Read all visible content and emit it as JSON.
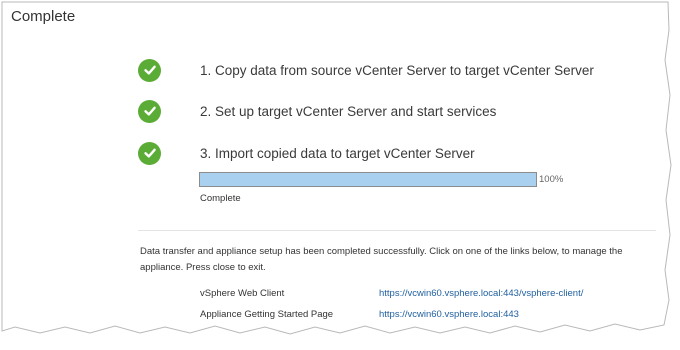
{
  "page": {
    "title": "Complete"
  },
  "steps": [
    {
      "label": "1. Copy data from source vCenter Server to target vCenter Server",
      "status_icon": "check-icon",
      "status": "complete"
    },
    {
      "label": "2. Set up target vCenter Server and start services",
      "status_icon": "check-icon",
      "status": "complete"
    },
    {
      "label": "3. Import copied data to target vCenter Server",
      "status_icon": "check-icon",
      "status": "complete"
    }
  ],
  "progress": {
    "value": 100,
    "label": "100%",
    "status": "Complete"
  },
  "summary": {
    "message": "Data transfer and appliance setup has been completed successfully. Click on one of the links below, to manage the appliance. Press close to exit."
  },
  "links": [
    {
      "label": "vSphere Web Client",
      "url": "https://vcwin60.vsphere.local:443/vsphere-client/"
    },
    {
      "label": "Appliance Getting Started Page",
      "url": "https://vcwin60.vsphere.local:443"
    }
  ],
  "colors": {
    "check": "#5aac37",
    "progress_fill": "#a9d1ef",
    "link": "#1f5f9f"
  }
}
